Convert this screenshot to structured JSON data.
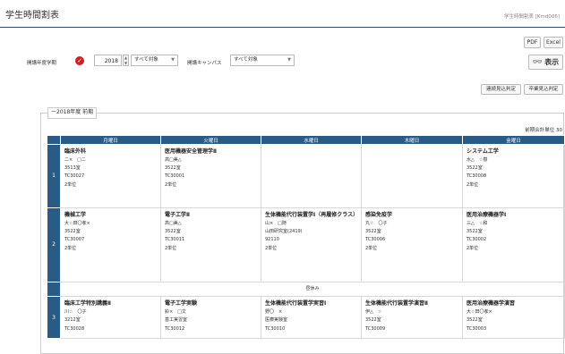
{
  "header": {
    "title": "学生時間割表",
    "page_id": "学生時間割表 [Kmd006]"
  },
  "toolbar": {
    "pdf_label": "PDF",
    "excel_label": "Excel",
    "show_label": "表示",
    "show_icon": "binoculars-icon"
  },
  "filters": {
    "year_label": "開講年度学期",
    "year_value": "2018",
    "target_value": "すべて対象",
    "campus_label": "開講キャンパス",
    "campus_value": "すべて対象"
  },
  "actions": {
    "renzoku_label": "連続見込判定",
    "sotsugyo_label": "卒業見込判定"
  },
  "section": {
    "legend": "ー2018年度 前期",
    "total_label": "前期合計単位 30"
  },
  "timetable": {
    "days": [
      "月曜日",
      "火曜日",
      "水曜日",
      "木曜日",
      "金曜日"
    ],
    "periods": [
      {
        "period": "1",
        "cells": [
          {
            "name": "臨床外科",
            "lines": [
              "ニ×　□ニ",
              "3513室",
              "TC30027",
              "2単位"
            ]
          },
          {
            "name": "医用機器安全管理学Ⅱ",
            "lines": [
              "高□美△",
              "3522室",
              "TC30001",
              "2単位"
            ]
          },
          {
            "name": "",
            "lines": []
          },
          {
            "name": "",
            "lines": []
          },
          {
            "name": "システム工学",
            "lines": [
              "水△　☆樹",
              "3522室",
              "TC30008",
              "2単位"
            ]
          }
        ]
      },
      {
        "period": "2",
        "cells": [
          {
            "name": "機械工学",
            "lines": [
              "大☆田〇孝×",
              "3522室",
              "TC30007",
              "2単位"
            ]
          },
          {
            "name": "電子工学Ⅱ",
            "lines": [
              "高□美△",
              "3522室",
              "TC30011",
              "2単位"
            ]
          },
          {
            "name": "生体機能代行装置学Ⅰ（再履修クラス）",
            "lines": [
              "山×　□随",
              "山田研究室(2419)",
              "92110",
              "2単位"
            ]
          },
          {
            "name": "感染免疫学",
            "lines": [
              "丸☆　〇子",
              "3522室",
              "TC30006",
              "2単位"
            ]
          },
          {
            "name": "医用治療機器学Ⅰ",
            "lines": [
              "三△　☆和",
              "3522室",
              "TC30002",
              "2単位"
            ]
          }
        ]
      },
      {
        "period": "3",
        "cells": [
          {
            "name": "臨床工学特別講義Ⅱ",
            "lines": [
              "川☆　〇子",
              "3212室",
              "TC30028"
            ]
          },
          {
            "name": "電子工学実験",
            "lines": [
              "鈴×　□文",
              "基工実習室",
              "TC30012"
            ]
          },
          {
            "name": "生体機能代行装置学実習Ⅰ",
            "lines": [
              "野〇　×",
              "医療実験室",
              "TC30010"
            ]
          },
          {
            "name": "生体機能代行装置学演習Ⅱ",
            "lines": [
              "伊△　☆",
              "3522室",
              "TC30009"
            ]
          },
          {
            "name": "医用治療機器学演習",
            "lines": [
              "大☆田〇孝×",
              "3522室",
              "TC30003"
            ]
          }
        ]
      }
    ],
    "break_label": "昼休み"
  }
}
